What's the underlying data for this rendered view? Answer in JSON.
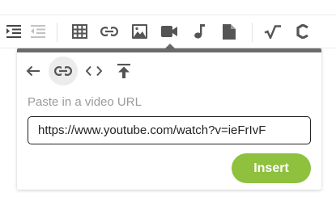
{
  "toolbar": {
    "buttons": [
      {
        "icon": "indent-icon"
      },
      {
        "icon": "outdent-icon"
      },
      {
        "icon": "table-icon"
      },
      {
        "icon": "link-icon"
      },
      {
        "icon": "image-icon"
      },
      {
        "icon": "video-icon",
        "active": true
      },
      {
        "icon": "audio-icon"
      },
      {
        "icon": "file-icon"
      },
      {
        "icon": "math-icon"
      },
      {
        "icon": "chemistry-icon"
      }
    ]
  },
  "video_popup": {
    "buttons": [
      {
        "icon": "back-arrow-icon"
      },
      {
        "icon": "link-icon",
        "active": true
      },
      {
        "icon": "embed-code-icon"
      },
      {
        "icon": "upload-icon"
      }
    ],
    "label": "Paste in a video URL",
    "url_value": "https://www.youtube.com/watch?v=ieFrIvF",
    "insert_label": "Insert"
  },
  "colors": {
    "accent": "#8fc13e",
    "popup_border": "#6a6a6a",
    "icon": "#555555"
  }
}
